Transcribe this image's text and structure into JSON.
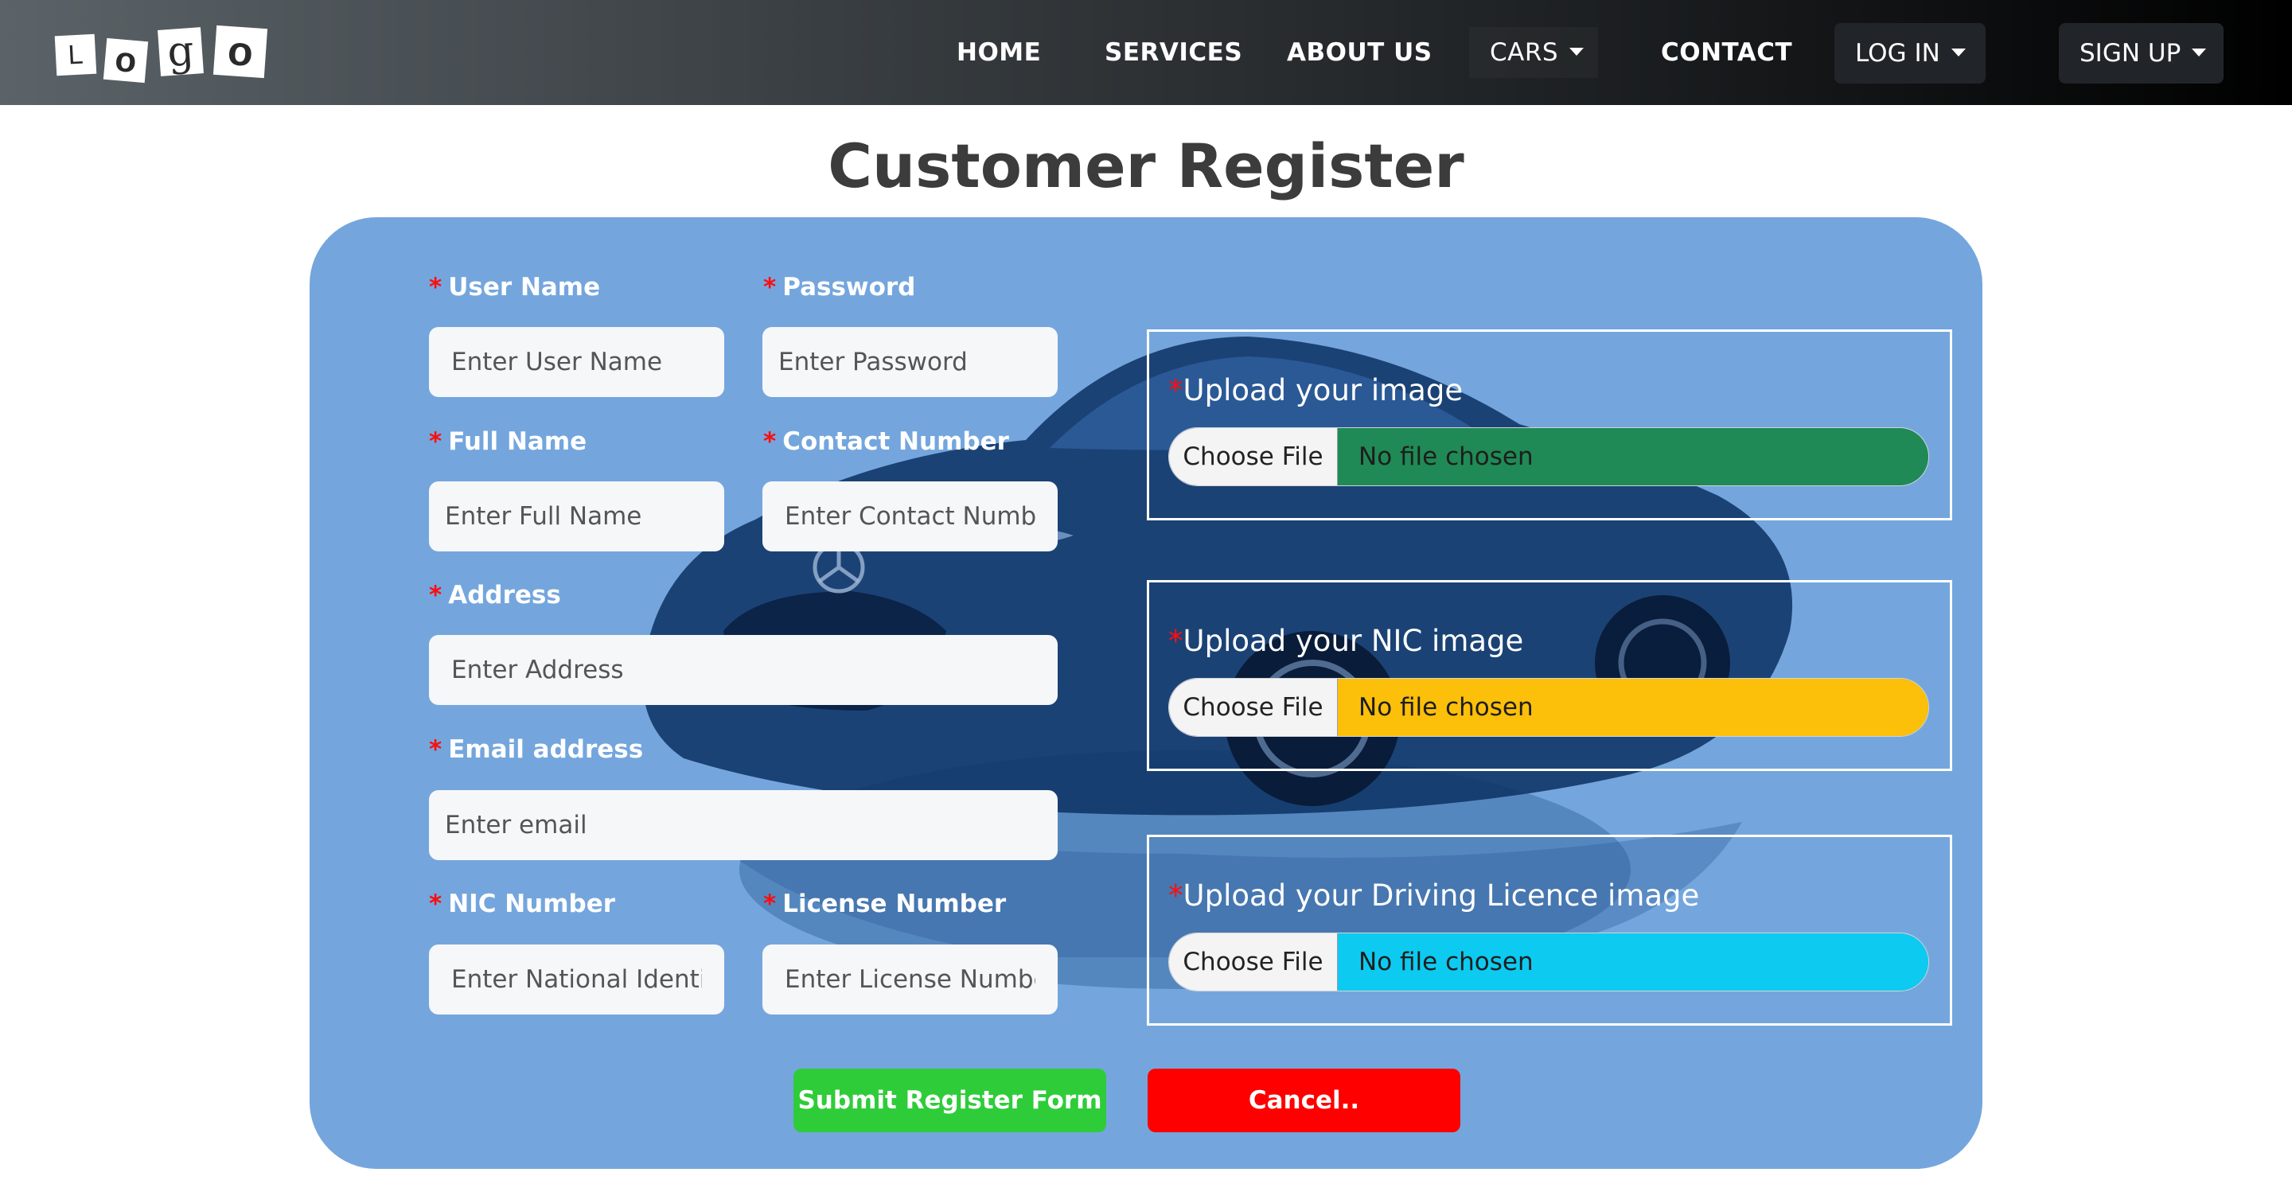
{
  "navbar": {
    "logo_letters": [
      "L",
      "o",
      "g",
      "o"
    ],
    "links": {
      "home": "HOME",
      "services": "SERVICES",
      "about": "ABOUT US",
      "cars": "CARS",
      "contact": "CONTACT"
    },
    "login": "LOG IN",
    "signup": "SIGN UP"
  },
  "page": {
    "title": "Customer Register"
  },
  "form": {
    "required_mark": "*",
    "fields": {
      "username": {
        "label": "User Name",
        "placeholder": "Enter User Name"
      },
      "password": {
        "label": "Password",
        "placeholder": "Enter Password"
      },
      "fullname": {
        "label": "Full Name",
        "placeholder": "Enter Full Name"
      },
      "contact": {
        "label": "Contact Number",
        "placeholder": "Enter Contact Number"
      },
      "address": {
        "label": "Address",
        "placeholder": "Enter Address"
      },
      "email": {
        "label": "Email address",
        "placeholder": "Enter email"
      },
      "nic": {
        "label": "NIC Number",
        "placeholder": "Enter National Identity Card Number"
      },
      "license": {
        "label": "License Number",
        "placeholder": "Enter License Number"
      }
    },
    "uploads": [
      {
        "label": "Upload your image",
        "button": "Choose File",
        "status": "No file chosen",
        "color": "#1f8a55"
      },
      {
        "label": "Upload your NIC image",
        "button": "Choose File",
        "status": "No file chosen",
        "color": "#fcbf0a"
      },
      {
        "label": "Upload your Driving Licence image",
        "button": "Choose File",
        "status": "No file chosen",
        "color": "#0dcaf0"
      }
    ],
    "submit": "Submit Register Form",
    "cancel": "Cancel.."
  },
  "colors": {
    "card_bg": "#74a6dd",
    "submit": "#2fcc3a",
    "cancel": "#ff0000",
    "required": "#ff0d0d"
  }
}
